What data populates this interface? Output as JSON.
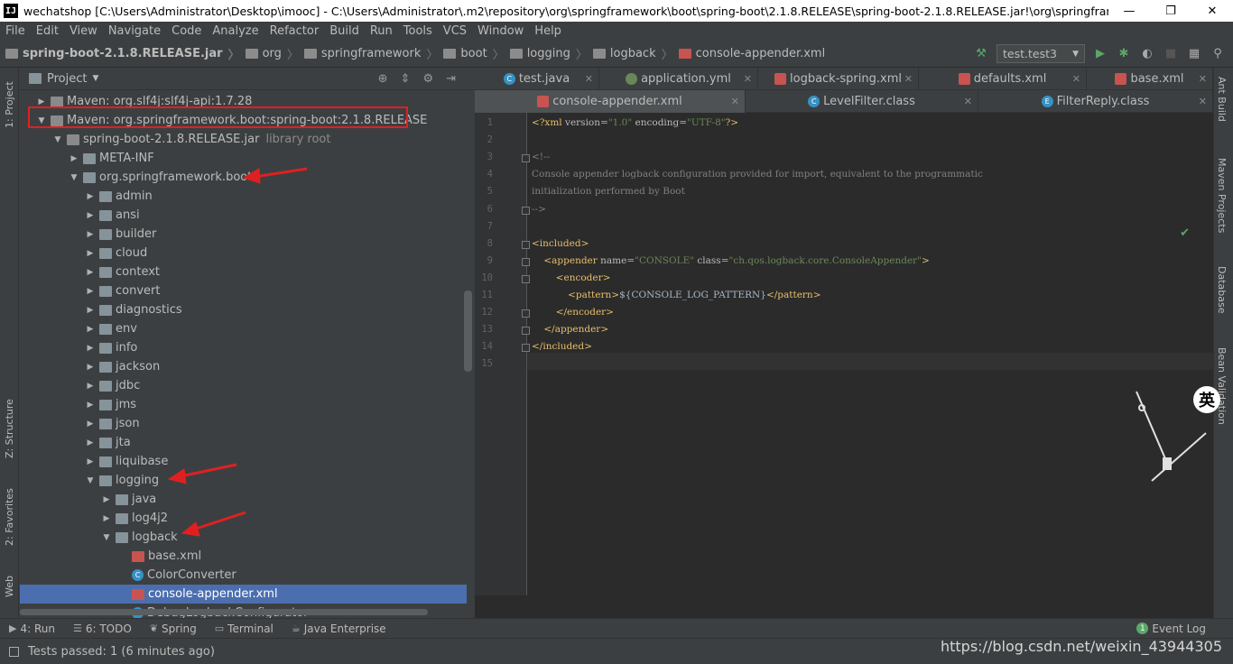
{
  "window": {
    "title": "wechatshop [C:\\Users\\Administrator\\Desktop\\imooc] - C:\\Users\\Administrator\\.m2\\repository\\org\\springframework\\boot\\spring-boot\\2.1.8.RELEASE\\spring-boot-2.1.8.RELEASE.jar!\\org\\springframework\\...",
    "minimize": "—",
    "maximize": "❐",
    "close": "✕"
  },
  "menu": [
    "File",
    "Edit",
    "View",
    "Navigate",
    "Code",
    "Analyze",
    "Refactor",
    "Build",
    "Run",
    "Tools",
    "VCS",
    "Window",
    "Help"
  ],
  "breadcrumb": [
    "spring-boot-2.1.8.RELEASE.jar",
    "org",
    "springframework",
    "boot",
    "logging",
    "logback",
    "console-appender.xml"
  ],
  "run_config": "test.test3",
  "left_strip": {
    "project": "1: Project",
    "structure": "Z: Structure",
    "favorites": "2: Favorites",
    "web": "Web"
  },
  "right_strip": {
    "ant": "Ant Build",
    "maven": "Maven Projects",
    "database": "Database",
    "bean": "Bean Validation"
  },
  "project_panel": {
    "title": "Project"
  },
  "tree": [
    {
      "label": "Maven: org.slf4j:slf4j-api:1.7.28",
      "indent": 0,
      "arrow": "▶",
      "icon": "lib"
    },
    {
      "label": "Maven: org.springframework.boot:spring-boot:2.1.8.RELEASE",
      "indent": 0,
      "arrow": "▼",
      "icon": "lib"
    },
    {
      "label": "spring-boot-2.1.8.RELEASE.jar",
      "hint": "library root",
      "indent": 1,
      "arrow": "▼",
      "icon": "lib"
    },
    {
      "label": "META-INF",
      "indent": 2,
      "arrow": "▶",
      "icon": "folder"
    },
    {
      "label": "org.springframework.boot",
      "indent": 2,
      "arrow": "▼",
      "icon": "folder"
    },
    {
      "label": "admin",
      "indent": 3,
      "arrow": "▶",
      "icon": "folder"
    },
    {
      "label": "ansi",
      "indent": 3,
      "arrow": "▶",
      "icon": "folder"
    },
    {
      "label": "builder",
      "indent": 3,
      "arrow": "▶",
      "icon": "folder"
    },
    {
      "label": "cloud",
      "indent": 3,
      "arrow": "▶",
      "icon": "folder"
    },
    {
      "label": "context",
      "indent": 3,
      "arrow": "▶",
      "icon": "folder"
    },
    {
      "label": "convert",
      "indent": 3,
      "arrow": "▶",
      "icon": "folder"
    },
    {
      "label": "diagnostics",
      "indent": 3,
      "arrow": "▶",
      "icon": "folder"
    },
    {
      "label": "env",
      "indent": 3,
      "arrow": "▶",
      "icon": "folder"
    },
    {
      "label": "info",
      "indent": 3,
      "arrow": "▶",
      "icon": "folder"
    },
    {
      "label": "jackson",
      "indent": 3,
      "arrow": "▶",
      "icon": "folder"
    },
    {
      "label": "jdbc",
      "indent": 3,
      "arrow": "▶",
      "icon": "folder"
    },
    {
      "label": "jms",
      "indent": 3,
      "arrow": "▶",
      "icon": "folder"
    },
    {
      "label": "json",
      "indent": 3,
      "arrow": "▶",
      "icon": "folder"
    },
    {
      "label": "jta",
      "indent": 3,
      "arrow": "▶",
      "icon": "folder"
    },
    {
      "label": "liquibase",
      "indent": 3,
      "arrow": "▶",
      "icon": "folder"
    },
    {
      "label": "logging",
      "indent": 3,
      "arrow": "▼",
      "icon": "folder"
    },
    {
      "label": "java",
      "indent": 4,
      "arrow": "▶",
      "icon": "folder"
    },
    {
      "label": "log4j2",
      "indent": 4,
      "arrow": "▶",
      "icon": "folder"
    },
    {
      "label": "logback",
      "indent": 4,
      "arrow": "▼",
      "icon": "folder"
    },
    {
      "label": "base.xml",
      "indent": 5,
      "arrow": "",
      "icon": "xml"
    },
    {
      "label": "ColorConverter",
      "indent": 5,
      "arrow": "",
      "icon": "cls"
    },
    {
      "label": "console-appender.xml",
      "indent": 5,
      "arrow": "",
      "icon": "xml",
      "selected": true
    },
    {
      "label": "DebugLogbackConfigurator",
      "indent": 5,
      "arrow": "",
      "icon": "cls"
    }
  ],
  "tabs_row1": [
    {
      "label": "test.java",
      "icon": "cls",
      "color": "#3592c4"
    },
    {
      "label": "application.yml",
      "icon": "yml",
      "color": "#6a8759"
    },
    {
      "label": "logback-spring.xml",
      "icon": "xml",
      "color": "#c75450"
    },
    {
      "label": "defaults.xml",
      "icon": "xml",
      "color": "#c75450"
    },
    {
      "label": "base.xml",
      "icon": "xml",
      "color": "#c75450"
    }
  ],
  "tabs_row2": [
    {
      "label": "console-appender.xml",
      "icon": "xml",
      "color": "#c75450",
      "active": true
    },
    {
      "label": "LevelFilter.class",
      "icon": "cls",
      "color": "#3592c4"
    },
    {
      "label": "FilterReply.class",
      "icon": "enum",
      "color": "#3592c4"
    }
  ],
  "code": [
    {
      "n": "1",
      "parts": [
        [
          "tag",
          "<?xml "
        ],
        [
          "attr",
          "version="
        ],
        [
          "val",
          "\"1.0\""
        ],
        [
          "attr",
          " encoding="
        ],
        [
          "val",
          "\"UTF-8\""
        ],
        [
          "tag",
          "?>"
        ]
      ]
    },
    {
      "n": "2",
      "parts": []
    },
    {
      "n": "3",
      "parts": [
        [
          "comment",
          "<!--"
        ]
      ]
    },
    {
      "n": "4",
      "parts": [
        [
          "comment",
          "Console appender logback configuration provided for import, equivalent to the programmatic"
        ]
      ]
    },
    {
      "n": "5",
      "parts": [
        [
          "comment",
          "initialization performed by Boot"
        ]
      ]
    },
    {
      "n": "6",
      "parts": [
        [
          "comment",
          "-->"
        ]
      ]
    },
    {
      "n": "7",
      "parts": []
    },
    {
      "n": "8",
      "parts": [
        [
          "tag",
          "<included>"
        ]
      ]
    },
    {
      "n": "9",
      "parts": [
        [
          "plain",
          "    "
        ],
        [
          "tag",
          "<appender "
        ],
        [
          "attr",
          "name="
        ],
        [
          "val",
          "\"CONSOLE\""
        ],
        [
          "attr",
          " class="
        ],
        [
          "val",
          "\"ch.qos.logback.core.ConsoleAppender\""
        ],
        [
          "tag",
          ">"
        ]
      ]
    },
    {
      "n": "10",
      "parts": [
        [
          "plain",
          "        "
        ],
        [
          "tag",
          "<encoder>"
        ]
      ]
    },
    {
      "n": "11",
      "parts": [
        [
          "plain",
          "            "
        ],
        [
          "tag",
          "<pattern>"
        ],
        [
          "plain",
          "${CONSOLE_LOG_PATTERN}"
        ],
        [
          "tag",
          "</pattern>"
        ]
      ]
    },
    {
      "n": "12",
      "parts": [
        [
          "plain",
          "        "
        ],
        [
          "tag",
          "</encoder>"
        ]
      ]
    },
    {
      "n": "13",
      "parts": [
        [
          "plain",
          "    "
        ],
        [
          "tag",
          "</appender>"
        ]
      ]
    },
    {
      "n": "14",
      "parts": [
        [
          "tag",
          "</included>"
        ]
      ]
    },
    {
      "n": "15",
      "parts": []
    }
  ],
  "bottom_tabs": [
    {
      "label": "4: Run",
      "icon": "▶"
    },
    {
      "label": "6: TODO",
      "icon": "☰"
    },
    {
      "label": "Spring",
      "icon": "❦"
    },
    {
      "label": "Terminal",
      "icon": "▭"
    },
    {
      "label": "Java Enterprise",
      "icon": "☕"
    }
  ],
  "event_log": "Event Log",
  "event_count": "1",
  "status": "Tests passed: 1 (6 minutes ago)",
  "watermark": "https://blog.csdn.net/weixin_43944305",
  "ime": "英",
  "accent_colors": {
    "selection": "#4b6eaf",
    "annotation": "#e02020"
  }
}
